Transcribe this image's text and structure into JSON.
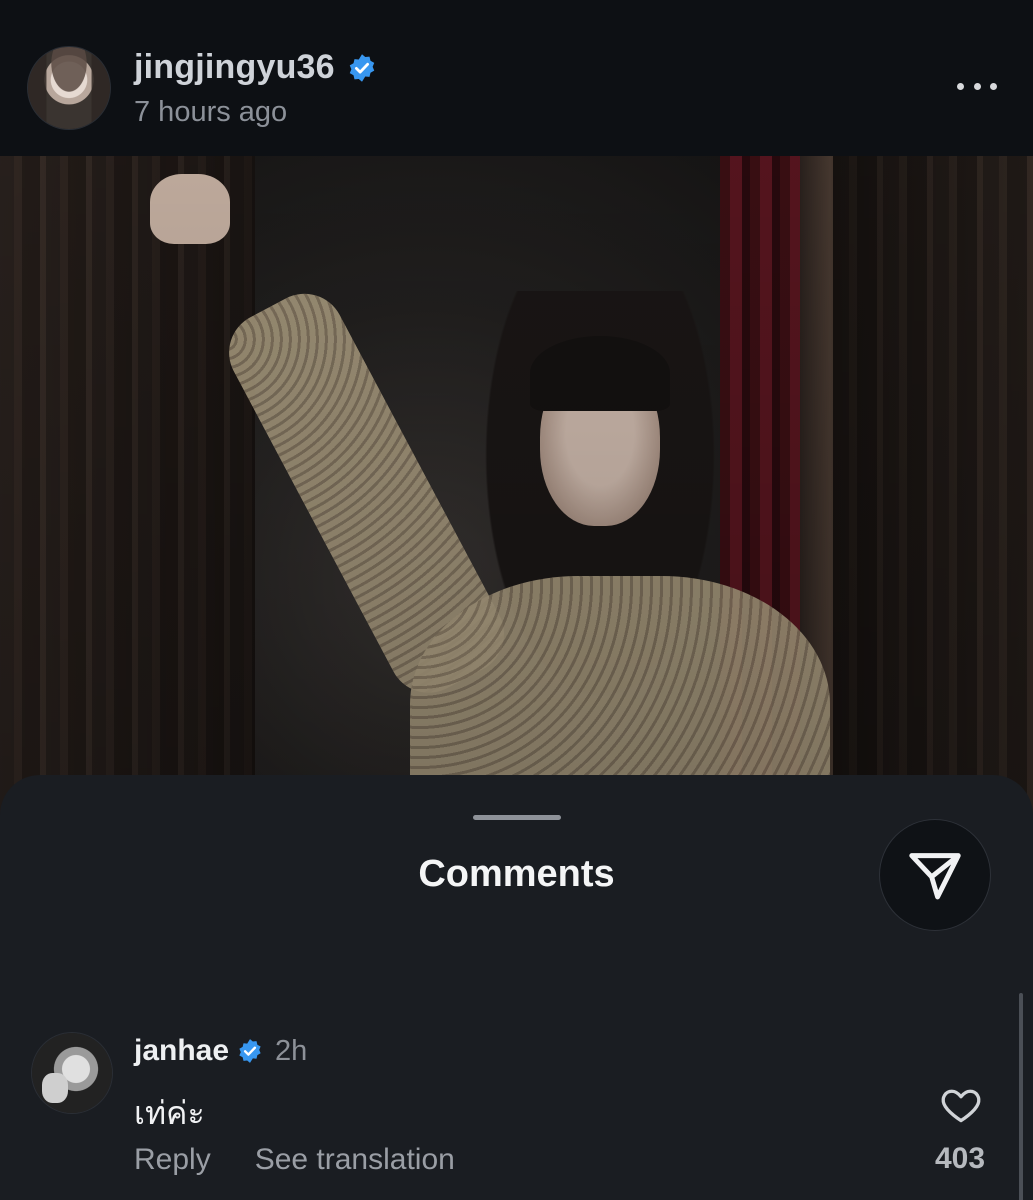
{
  "post": {
    "username": "jingjingyu36",
    "time_ago": "7 hours ago",
    "verified": true
  },
  "colors": {
    "verified_badge": "#3897f0",
    "sheet_bg": "#1a1d22",
    "header_bg": "#0d1014"
  },
  "icons": {
    "verified": "verified-badge-icon",
    "more": "more-options-icon",
    "share": "send-icon",
    "like": "heart-icon"
  },
  "sheet": {
    "title": "Comments"
  },
  "comment": {
    "username": "janhae",
    "verified": true,
    "time": "2h",
    "text": "เท่ค่ะ",
    "reply_label": "Reply",
    "translate_label": "See translation",
    "like_count": "403"
  }
}
